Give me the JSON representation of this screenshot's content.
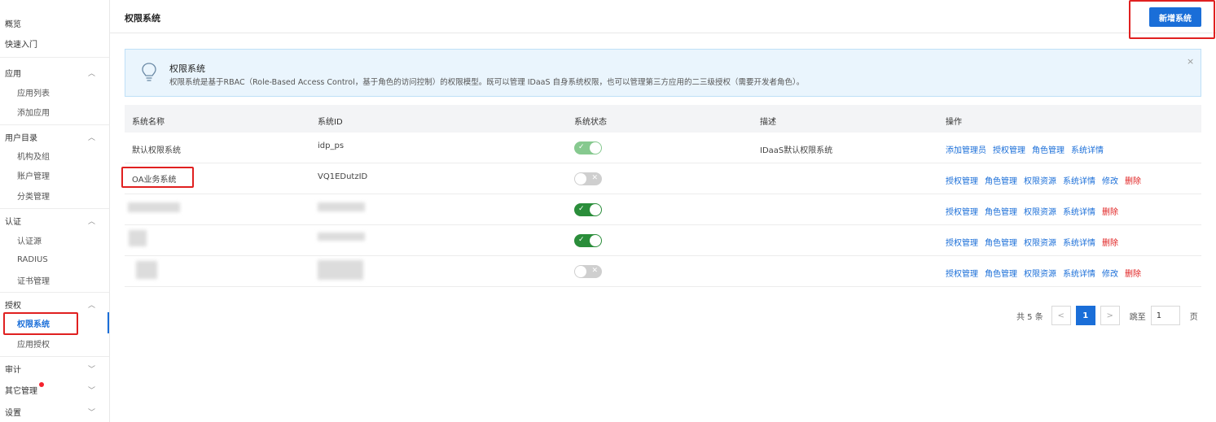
{
  "sidebar": {
    "overview": "概览",
    "quickstart": "快速入门",
    "apps": {
      "label": "应用",
      "items": [
        "应用列表",
        "添加应用"
      ]
    },
    "directory": {
      "label": "用户目录",
      "items": [
        "机构及组",
        "账户管理",
        "分类管理"
      ]
    },
    "auth": {
      "label": "认证",
      "items": [
        "认证源",
        "RADIUS",
        "证书管理"
      ]
    },
    "authorization": {
      "label": "授权",
      "items": [
        "权限系统",
        "应用授权"
      ]
    },
    "audit": "审计",
    "other": "其它管理",
    "settings": "设置"
  },
  "header": {
    "title": "权限系统",
    "new_button": "新增系统"
  },
  "banner": {
    "title": "权限系统",
    "description": "权限系统是基于RBAC（Role-Based Access Control，基于角色的访问控制）的权限模型。既可以管理 IDaaS 自身系统权限，也可以管理第三方应用的二三级授权（需要开发者角色）。",
    "close": "×"
  },
  "table": {
    "columns": [
      "系统名称",
      "系统ID",
      "系统状态",
      "描述",
      "操作"
    ],
    "rows": [
      {
        "name": "默认权限系统",
        "id": "idp_ps",
        "enabled": true,
        "description": "IDaaS默认权限系统",
        "actions": [
          "添加管理员",
          "授权管理",
          "角色管理",
          "系统详情"
        ]
      },
      {
        "name": "OA业务系统",
        "id": "VQ1EDutzID",
        "enabled": false,
        "description": "",
        "actions": [
          "授权管理",
          "角色管理",
          "权限资源",
          "系统详情",
          "修改",
          "删除"
        ]
      },
      {
        "name": "",
        "id": "",
        "enabled": true,
        "description": "",
        "actions": [
          "授权管理",
          "角色管理",
          "权限资源",
          "系统详情",
          "删除"
        ]
      },
      {
        "name": "",
        "id": "",
        "enabled": true,
        "description": "",
        "actions": [
          "授权管理",
          "角色管理",
          "权限资源",
          "系统详情",
          "删除"
        ]
      },
      {
        "name": "",
        "id": "",
        "enabled": false,
        "description": "",
        "actions": [
          "授权管理",
          "角色管理",
          "权限资源",
          "系统详情",
          "修改",
          "删除"
        ]
      }
    ]
  },
  "pagination": {
    "total": "共 5 条",
    "prev": "<",
    "current": "1",
    "next": ">",
    "goto": "跳至",
    "page_value": "1",
    "page_unit": "页"
  },
  "colors": {
    "accent": "#1a6ed8",
    "danger": "#e02020",
    "toggle_on": "#2a8d3a",
    "toggle_off": "#cfcfcf"
  },
  "icons": {
    "banner": "lightbulb-icon",
    "expand": "chevron-up-icon",
    "collapse": "chevron-down-icon"
  }
}
